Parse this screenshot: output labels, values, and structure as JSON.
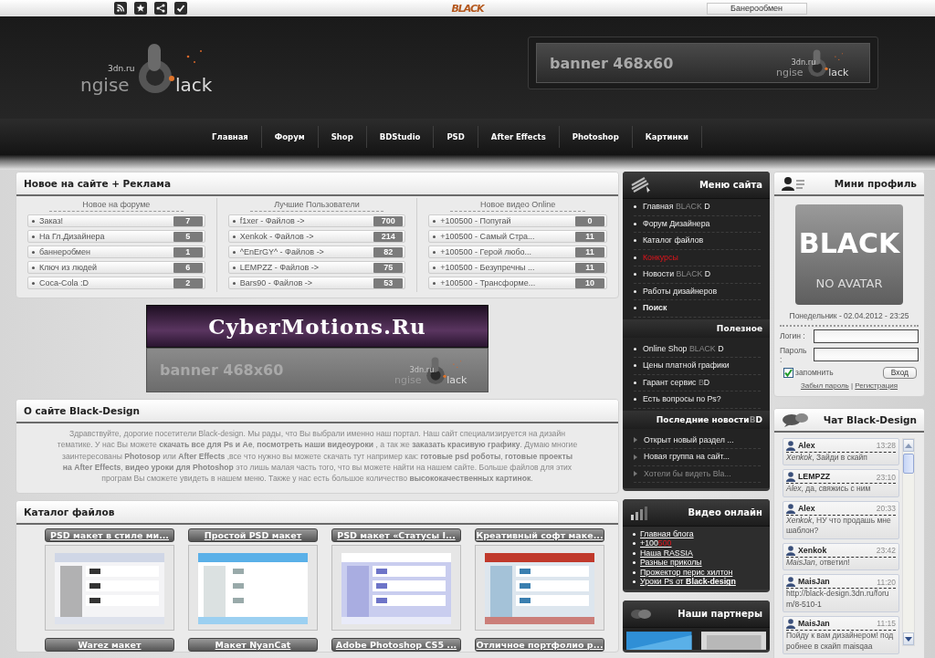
{
  "topbar": {
    "logo": "BLACK",
    "button": "Банерообмен"
  },
  "header": {
    "logo": {
      "domain": "3dn.ru",
      "left": "ngise",
      "right": "lack"
    },
    "banner": {
      "text": "banner 468x60",
      "logo": {
        "domain": "3dn.ru",
        "left": "ngise",
        "right": "lack"
      }
    }
  },
  "nav": [
    "Главная",
    "Форум",
    "Shop",
    "BDStudio",
    "PSD",
    "After Effects",
    "Photoshop",
    "Картинки"
  ],
  "news_panel": {
    "title": "Новое на сайте + Реклама",
    "columns": [
      {
        "heading": "Новое на форуме",
        "items": [
          {
            "text": "Заказ!",
            "count": "7"
          },
          {
            "text": "На Гл.Дизайнера",
            "count": "5"
          },
          {
            "text": "баннеробмен",
            "count": "1"
          },
          {
            "text": "Ключ из людей",
            "count": "6"
          },
          {
            "text": "Coca-Cola :D",
            "count": "2"
          }
        ]
      },
      {
        "heading": "Лучшие Пользователи",
        "items": [
          {
            "text": "f1xer - Файлов ->",
            "count": "700"
          },
          {
            "text": "Xenkok - Файлов ->",
            "count": "214"
          },
          {
            "text": "^EnErGY^ - Файлов ->",
            "count": "82"
          },
          {
            "text": "LEMPZZ - Файлов ->",
            "count": "75"
          },
          {
            "text": "Bars90 - Файлов ->",
            "count": "53"
          }
        ]
      },
      {
        "heading": "Новое видео Online",
        "items": [
          {
            "text": "+100500 - Попугай",
            "count": "0"
          },
          {
            "text": "+100500 - Самый Стра...",
            "count": "11"
          },
          {
            "text": "+100500 - Герой любо...",
            "count": "11"
          },
          {
            "text": "+100500 - Безупречны ...",
            "count": "11"
          },
          {
            "text": "+100500 - Трансформе...",
            "count": "10"
          }
        ]
      }
    ]
  },
  "ad": {
    "title": "CyberMotions.Ru",
    "banner": {
      "text": "banner 468x60",
      "logo": {
        "domain": "3dn.ru",
        "left": "ngise",
        "right": "lack"
      }
    }
  },
  "about": {
    "title": "О сайте Black-Design",
    "text": "Здравствуйте, дорогие посетители Black-design. Мы рады, что Вы выбрали именно наш портал. Наш сайт специализируется на дизайн тематике. У нас Вы можете **скачать все для Ps и Ae**, **посмотреть наши видеоуроки** , а так же **заказать красивую графику**. Думаю многие заинтересованы **Photosop** или **After Effects** ,все что нужно вы можете скачать тут например как: **готовые psd роботы**, **готовые проекты на After Effects**, **видео уроки для Photoshop** это лишь малая часть того, что вы можете найти на нашем сайте. Больше файлов для этих програм Вы сможете увидеть в нашем меню. Также у нас есть большое количество **высококачественных картинок**."
  },
  "catalog": {
    "title": "Каталог файлов",
    "items": [
      {
        "title": "PSD макет в стиле ми...",
        "kind": "preview"
      },
      {
        "title": "Простой PSD макет",
        "kind": "preview"
      },
      {
        "title": "PSD макет «Статусы I...",
        "kind": "preview"
      },
      {
        "title": "Креативный софт маке...",
        "kind": "preview"
      },
      {
        "title": "Warez макет",
        "kind": "title"
      },
      {
        "title": "Макет NyanCat",
        "kind": "title"
      },
      {
        "title": "Adobe Photoshop CS5 ...",
        "kind": "title"
      },
      {
        "title": "Отличное портфолио р...",
        "kind": "title"
      }
    ]
  },
  "menu": {
    "title": "Меню сайта",
    "sections": [
      {
        "items": [
          {
            "kind": "link",
            "text": "Главная ",
            "brand": "BLACK",
            "after": " D"
          },
          {
            "kind": "link",
            "text": "Форум Дизайнера"
          },
          {
            "kind": "link",
            "text": "Каталог файлов"
          },
          {
            "kind": "accent",
            "text": "Конкурсы"
          },
          {
            "kind": "link",
            "text": "Новости ",
            "brand": "BLACK",
            "after": " D"
          },
          {
            "kind": "link",
            "text": "Работы дизайнеров"
          },
          {
            "kind": "strong",
            "text": "Поиск"
          }
        ]
      },
      {
        "heading": {
          "text": "Полезное"
        },
        "items": [
          {
            "kind": "link",
            "text": "Online Shop ",
            "brand": "BLACK",
            "after": " D"
          },
          {
            "kind": "link",
            "text": "Цены платной графики"
          },
          {
            "kind": "link",
            "text": "Гарант сервис ",
            "brand": "B",
            "after": "D"
          },
          {
            "kind": "link",
            "text": "Есть вопросы по Ps?"
          }
        ]
      },
      {
        "heading": {
          "text": "Последние новости ",
          "brand": "B",
          "after": "D"
        },
        "items": [
          {
            "kind": "news",
            "text": "Открыт новый раздел ..."
          },
          {
            "kind": "news",
            "text": "Новая группа на сайт..."
          },
          {
            "kind": "news-faded",
            "text": "Хотели бы видеть Bla..."
          }
        ]
      }
    ]
  },
  "video": {
    "title": "Видео онлайн",
    "links": [
      {
        "text": "Главная блога"
      },
      {
        "text": "+100",
        "accent": "500"
      },
      {
        "text": "Наша RASSIA"
      },
      {
        "text": "Разные приколы"
      },
      {
        "text": "Прожектор перис хилтон"
      },
      {
        "text": "Уроки Ps от **Black-design**"
      }
    ]
  },
  "partners": {
    "title": "Наши партнеры"
  },
  "profile": {
    "title": "Мини профиль",
    "avatar": {
      "logo": "BLACK",
      "caption": "NO AVATAR"
    },
    "datetime": "Понедельник - 02.04.2012 - 23:25",
    "login_label": "Логин :",
    "password_label": "Пароль :",
    "remember": {
      "label": "запомнить",
      "checked": true
    },
    "submit": "Вход",
    "links": [
      "Забыл пароль",
      "Регистрация"
    ],
    "separator": "|"
  },
  "chat": {
    "title": "Чат Black-Design",
    "messages": [
      {
        "user": "Alex",
        "time": "13:28",
        "text": "*Xenkok*, Зайди в скайп"
      },
      {
        "user": "LEMPZZ",
        "time": "23:10",
        "text": "*Alex*, да, свяжись с ним"
      },
      {
        "user": "Alex",
        "time": "20:33",
        "text": "*Xenkok*, НУ что продашь мне шаблон?"
      },
      {
        "user": "Xenkok",
        "time": "23:42",
        "text": "*MaisJan*, ответил!"
      },
      {
        "user": "MaisJan",
        "time": "11:20",
        "text": "http://black-design.3dn.ru/forum/8-510-1"
      },
      {
        "user": "MaisJan",
        "time": "11:15",
        "text": "Пойду к вам дизайнером! подробнее в скайп maisqaa"
      }
    ]
  }
}
